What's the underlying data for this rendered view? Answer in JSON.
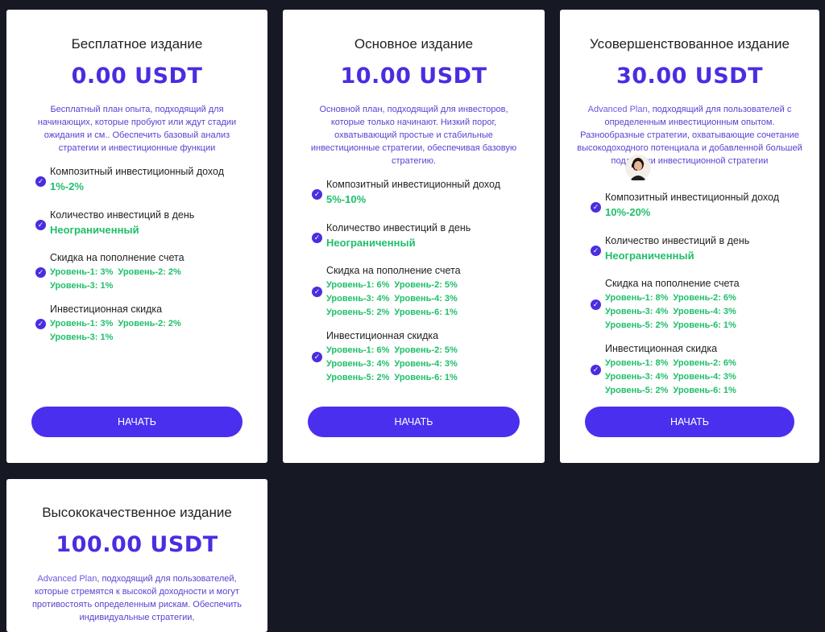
{
  "plans": [
    {
      "title": "Бесплатное издание",
      "price": "0.00 USDT",
      "description": "Бесплатный план опыта, подходящий для начинающих, которые пробуют или ждут стадии ожидания и см.. Обеспечить базовый анализ стратегии и инвестиционные функции",
      "income_label": "Композитный инвестиционный доход",
      "income_value": "1%-2%",
      "count_label": "Количество инвестиций в день",
      "count_value": "Неограниченный",
      "deposit_label": "Скидка на пополнение счета",
      "deposit_levels": [
        "Уровень-1: 3%",
        "Уровень-2: 2%",
        "Уровень-3: 1%"
      ],
      "invest_label": "Инвестиционная скидка",
      "invest_levels": [
        "Уровень-1: 3%",
        "Уровень-2: 2%",
        "Уровень-3: 1%"
      ],
      "button": "НАЧАТЬ"
    },
    {
      "title": "Основное издание",
      "price": "10.00 USDT",
      "description": "Основной план, подходящий для инвесторов, которые только начинают. Низкий порог, охватывающий простые и стабильные инвестиционные стратегии, обеспечивая базовую стратегию.",
      "income_label": "Композитный инвестиционный доход",
      "income_value": "5%-10%",
      "count_label": "Количество инвестиций в день",
      "count_value": "Неограниченный",
      "deposit_label": "Скидка на пополнение счета",
      "deposit_levels": [
        "Уровень-1: 6%",
        "Уровень-2: 5%",
        "Уровень-3: 4%",
        "Уровень-4: 3%",
        "Уровень-5: 2%",
        "Уровень-6: 1%"
      ],
      "invest_label": "Инвестиционная скидка",
      "invest_levels": [
        "Уровень-1: 6%",
        "Уровень-2: 5%",
        "Уровень-3: 4%",
        "Уровень-4: 3%",
        "Уровень-5: 2%",
        "Уровень-6: 1%"
      ],
      "button": "НАЧАТЬ"
    },
    {
      "title": "Усовершенствованное издание",
      "price": "30.00 USDT",
      "desc_prefix": "Advanced Plan",
      "description": ", подходящий для пользователей с определенным инвестиционным опытом. Разнообразные стратегии, охватывающие сочетание высокодоходного потенциала и добавленной большей поддержки инвестиционной стратегии",
      "income_label": "Композитный инвестиционный доход",
      "income_value": "10%-20%",
      "count_label": "Количество инвестиций в день",
      "count_value": "Неограниченный",
      "deposit_label": "Скидка на пополнение счета",
      "deposit_levels": [
        "Уровень-1: 8%",
        "Уровень-2: 6%",
        "Уровень-3: 4%",
        "Уровень-4: 3%",
        "Уровень-5: 2%",
        "Уровень-6: 1%"
      ],
      "invest_label": "Инвестиционная скидка",
      "invest_levels": [
        "Уровень-1: 8%",
        "Уровень-2: 6%",
        "Уровень-3: 4%",
        "Уровень-4: 3%",
        "Уровень-5: 2%",
        "Уровень-6: 1%"
      ],
      "button": "НАЧАТЬ"
    },
    {
      "title": "Высококачественное издание",
      "price": "100.00 USDT",
      "desc_prefix": "Advanced Plan",
      "description": ", подходящий для пользователей, которые стремятся к высокой доходности и могут противостоять определенным рискам. Обеспечить индивидуальные стратегии,"
    }
  ],
  "support_avatar": "support-agent-avatar"
}
